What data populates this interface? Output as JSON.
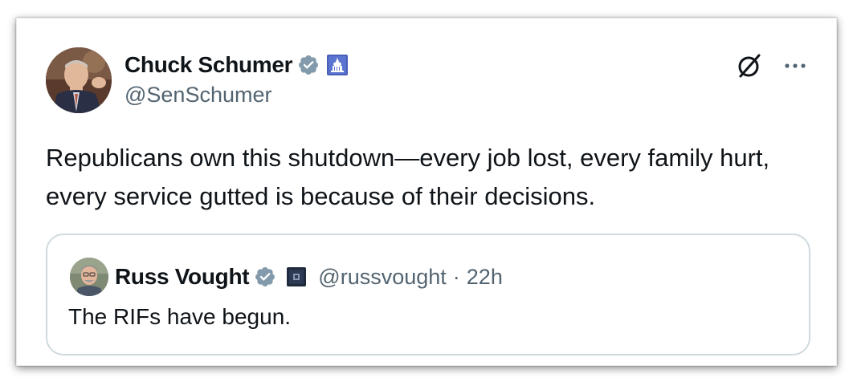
{
  "tweet": {
    "author": {
      "name": "Chuck Schumer",
      "handle": "@SenSchumer",
      "verified_icon": "verified-badge-icon",
      "affiliation_icon": "us-capitol-affiliation-icon"
    },
    "text": "Republicans own this shutdown—every job lost, every family hurt, every service gutted is because of their decisions.",
    "actions": {
      "grok_icon": "grok-icon",
      "more_icon": "more-options-icon"
    }
  },
  "quoted_tweet": {
    "author": {
      "name": "Russ Vought",
      "handle": "@russvought",
      "verified_icon": "verified-badge-icon",
      "affiliation_icon": "government-affiliation-icon"
    },
    "separator": "·",
    "time": "22h",
    "text": "The RIFs have begun."
  },
  "colors": {
    "verified_badge": "#829aab",
    "secondary_text": "#536471",
    "primary_text": "#0f1419",
    "border": "#cfd9de"
  }
}
